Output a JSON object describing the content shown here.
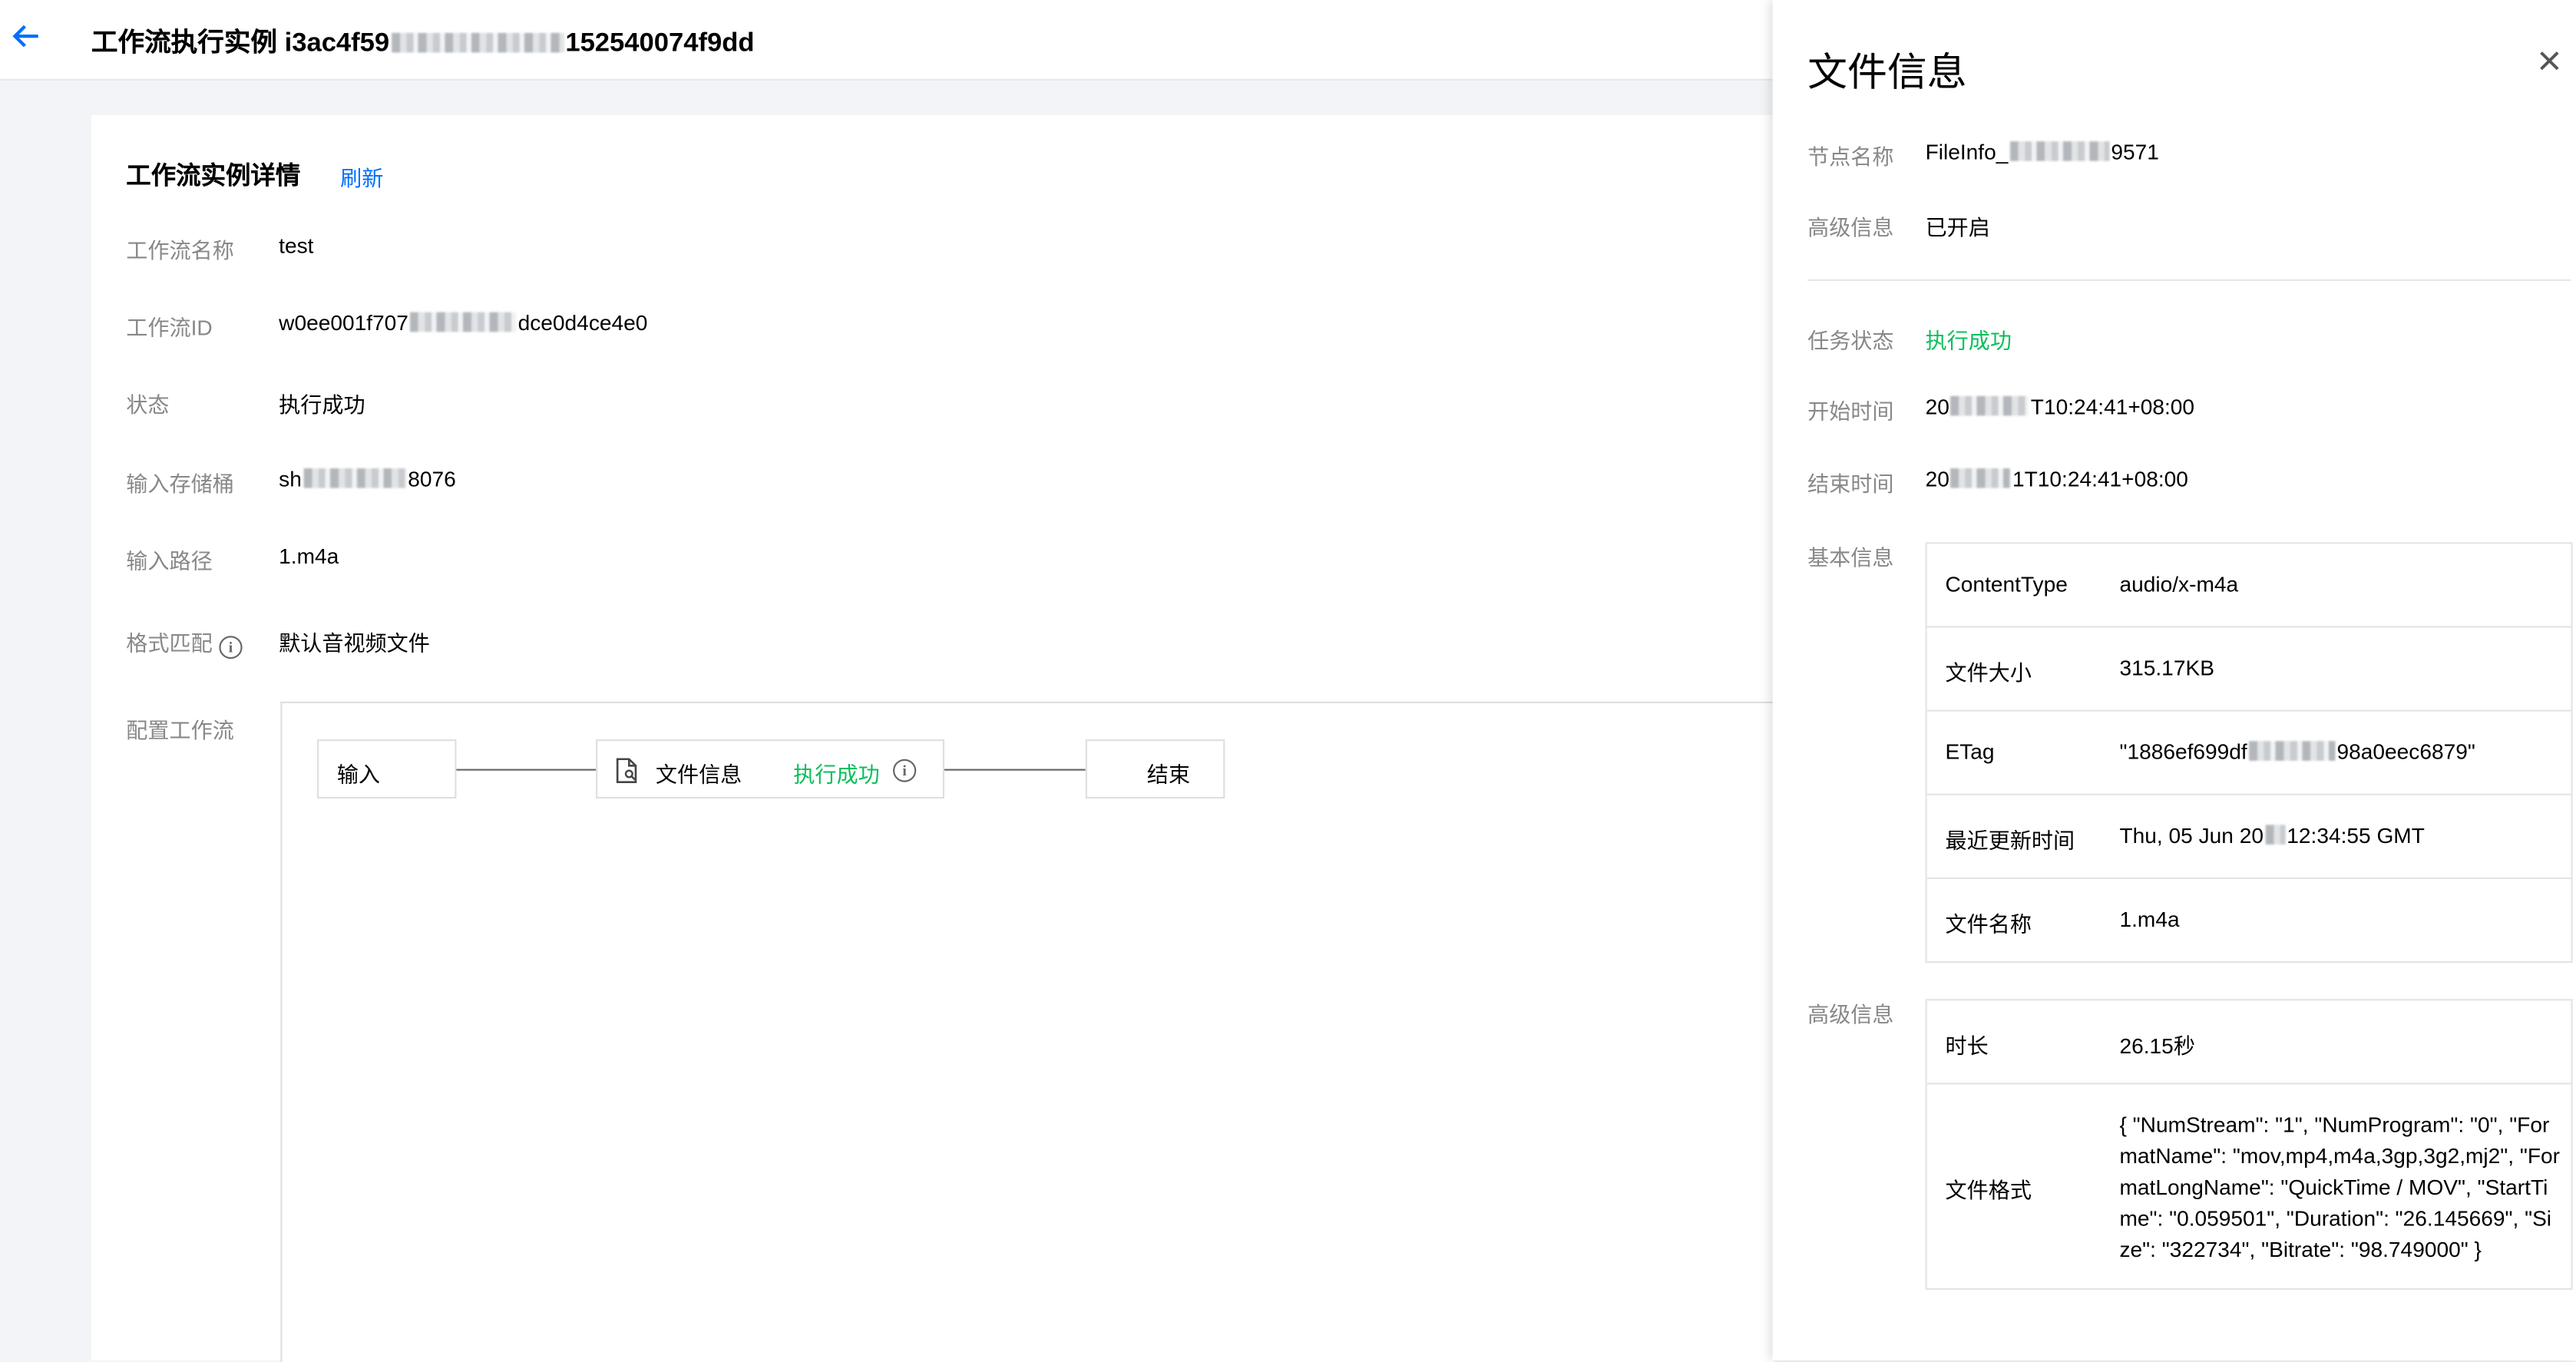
{
  "header": {
    "title_prefix": "工作流执行实例 i3ac4f59",
    "title_suffix": "152540074f9dd"
  },
  "detail": {
    "title": "工作流实例详情",
    "refresh_label": "刷新",
    "rows": {
      "name": {
        "label": "工作流名称",
        "value": "test"
      },
      "id": {
        "label": "工作流ID",
        "value_prefix": "w0ee001f707",
        "value_suffix": "dce0d4ce4e0"
      },
      "status": {
        "label": "状态",
        "value": "执行成功"
      },
      "bucket": {
        "label": "输入存储桶",
        "value_prefix": "sh",
        "value_suffix": "8076"
      },
      "path": {
        "label": "输入路径",
        "value": "1.m4a"
      },
      "format": {
        "label": "格式匹配",
        "value": "默认音视频文件"
      },
      "config": {
        "label": "配置工作流"
      }
    },
    "flow": {
      "input_label": "输入",
      "fileinfo_label": "文件信息",
      "fileinfo_status": "执行成功",
      "end_label": "结束"
    }
  },
  "drawer": {
    "title": "文件信息",
    "node_name": {
      "label": "节点名称",
      "value_prefix": "FileInfo_",
      "value_suffix": "9571"
    },
    "advanced": {
      "label": "高级信息",
      "value": "已开启"
    },
    "task_status": {
      "label": "任务状态",
      "value": "执行成功"
    },
    "start_time": {
      "label": "开始时间",
      "value_prefix": "20",
      "value_suffix": "T10:24:41+08:00"
    },
    "end_time": {
      "label": "结束时间",
      "value_prefix": "20",
      "value_suffix": "1T10:24:41+08:00"
    },
    "basic_info_label": "基本信息",
    "basic_info": {
      "content_type": {
        "key": "ContentType",
        "value": "audio/x-m4a"
      },
      "size": {
        "key": "文件大小",
        "value": "315.17KB"
      },
      "etag": {
        "key": "ETag",
        "value_prefix": "\"1886ef699df",
        "value_suffix": "98a0eec6879\""
      },
      "last_modified": {
        "key": "最近更新时间",
        "value_prefix": "Thu, 05 Jun 20",
        "value_suffix": "12:34:55 GMT"
      },
      "file_name": {
        "key": "文件名称",
        "value": "1.m4a"
      }
    },
    "advanced_info_label": "高级信息",
    "advanced_info": {
      "duration": {
        "key": "时长",
        "value": "26.15秒"
      },
      "format": {
        "key": "文件格式",
        "value": "{ \"NumStream\": \"1\", \"NumProgram\": \"0\", \"FormatName\": \"mov,mp4,m4a,3gp,3g2,mj2\", \"FormatLongName\": \"QuickTime / MOV\", \"StartTime\": \"0.059501\", \"Duration\": \"26.145669\", \"Size\": \"322734\", \"Bitrate\": \"98.749000\" }"
      }
    }
  },
  "colors": {
    "accent": "#006eff",
    "success": "#0abf5b",
    "label_gray": "#888888",
    "border": "#e1e4e8"
  }
}
